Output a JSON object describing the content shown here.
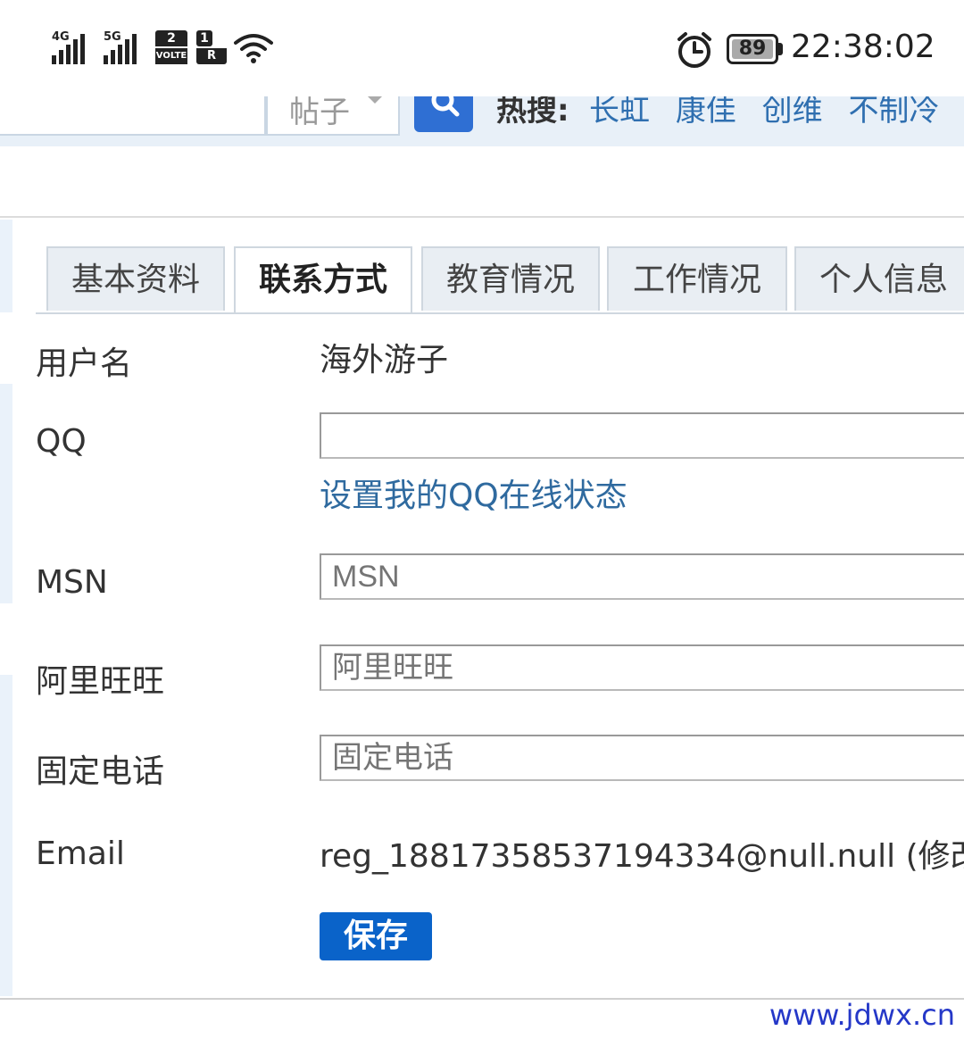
{
  "status_bar": {
    "network_1": "4G",
    "network_2": "5G",
    "sim_1_top": "2",
    "sim_1_bottom": "VOLTE",
    "sim_2_top": "1",
    "sim_2_bottom": "R",
    "battery": "89",
    "time": "22:38:02"
  },
  "search": {
    "scope": "帖子",
    "hot_label": "热搜:",
    "hot_links": [
      "长虹",
      "康佳",
      "创维",
      "不制冷"
    ]
  },
  "tabs": [
    {
      "label": "基本资料"
    },
    {
      "label": "联系方式",
      "active": true
    },
    {
      "label": "教育情况"
    },
    {
      "label": "工作情况"
    },
    {
      "label": "个人信息"
    }
  ],
  "form": {
    "username_label": "用户名",
    "username_value": "海外游子",
    "qq_label": "QQ",
    "qq_value": "",
    "qq_link": "设置我的QQ在线状态",
    "msn_label": "MSN",
    "msn_placeholder": "MSN",
    "wangwang_label": "阿里旺旺",
    "wangwang_placeholder": "阿里旺旺",
    "phone_label": "固定电话",
    "phone_placeholder": "固定电话",
    "email_label": "Email",
    "email_value": "reg_18817358537194334@null.null",
    "email_modify": "(修改)",
    "save_label": "保存"
  },
  "watermark": "www.jdwx.cn",
  "colors": {
    "tab_bg": "#e9eef3",
    "link": "#2f6a9f",
    "save_button": "#0a63c9",
    "search_button": "#2f6fd3",
    "watermark": "#2538c8"
  }
}
